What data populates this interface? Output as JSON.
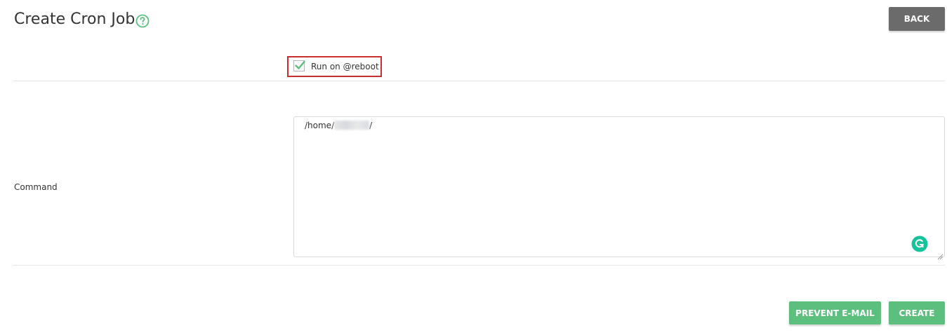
{
  "header": {
    "title": "Create Cron Job",
    "back_label": "BACK"
  },
  "form": {
    "reboot": {
      "label": "Run on @reboot",
      "checked": true
    },
    "command": {
      "label": "Command",
      "value_prefix": "/home/",
      "value_suffix": "/"
    }
  },
  "actions": {
    "prevent_email_label": "PREVENT E-MAIL",
    "create_label": "CREATE"
  },
  "colors": {
    "primary_green": "#5cbf7e",
    "back_gray": "#6b6b6b",
    "highlight_red": "#c9302c",
    "grammarly_teal": "#15c39a"
  },
  "icons": {
    "help": "question-circle",
    "checkbox": "checkmark",
    "grammarly": "grammarly-g"
  }
}
